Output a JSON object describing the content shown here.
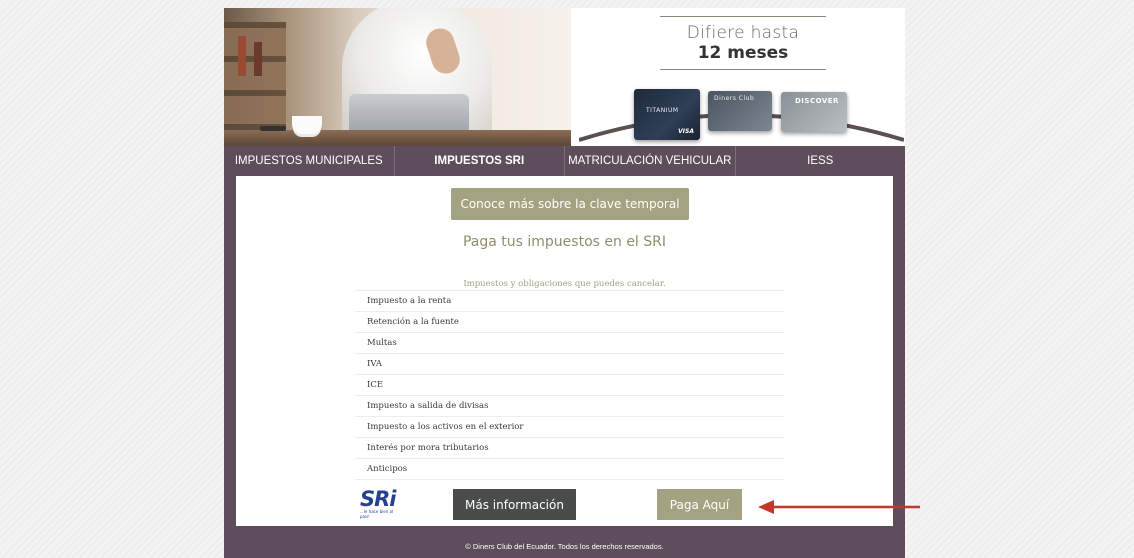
{
  "banner": {
    "promo_line1": "Difiere hasta",
    "promo_line2": "12 meses",
    "cards": [
      {
        "brand": "TITANIUM",
        "network": "VISA"
      },
      {
        "brand": "Diners Club"
      },
      {
        "brand": "DISCOVER"
      }
    ]
  },
  "nav": {
    "items": [
      {
        "label": "IMPUESTOS MUNICIPALES"
      },
      {
        "label": "IMPUESTOS SRI"
      },
      {
        "label": "MATRICULACIÓN VEHICULAR"
      },
      {
        "label": "IESS"
      }
    ],
    "active_index": 1
  },
  "main": {
    "clave_button": "Conoce más sobre la clave temporal",
    "title": "Paga tus impuestos en el SRI",
    "subtitle": "Impuestos y obligaciones que puedes cancelar.",
    "obligations": [
      "Impuesto a la renta",
      "Retención a la fuente",
      "Multas",
      "IVA",
      "ICE",
      "Impuesto a salida de divisas",
      "Impuesto a los activos en el exterior",
      "Interés por mora tributarios",
      "Anticipos"
    ],
    "logo_text": "SRi",
    "logo_tagline": "...le hace bien al país!",
    "info_button": "Más información",
    "pay_button": "Paga Aquí"
  },
  "footer": {
    "text": "© Diners Club del Ecuador. Todos los derechos reservados."
  },
  "colors": {
    "nav_bg": "#5e4e5c",
    "accent_olive": "#a3a381",
    "dark_button": "#4a4b4b",
    "arrow": "#c0392b",
    "sri_blue": "#24408f"
  }
}
